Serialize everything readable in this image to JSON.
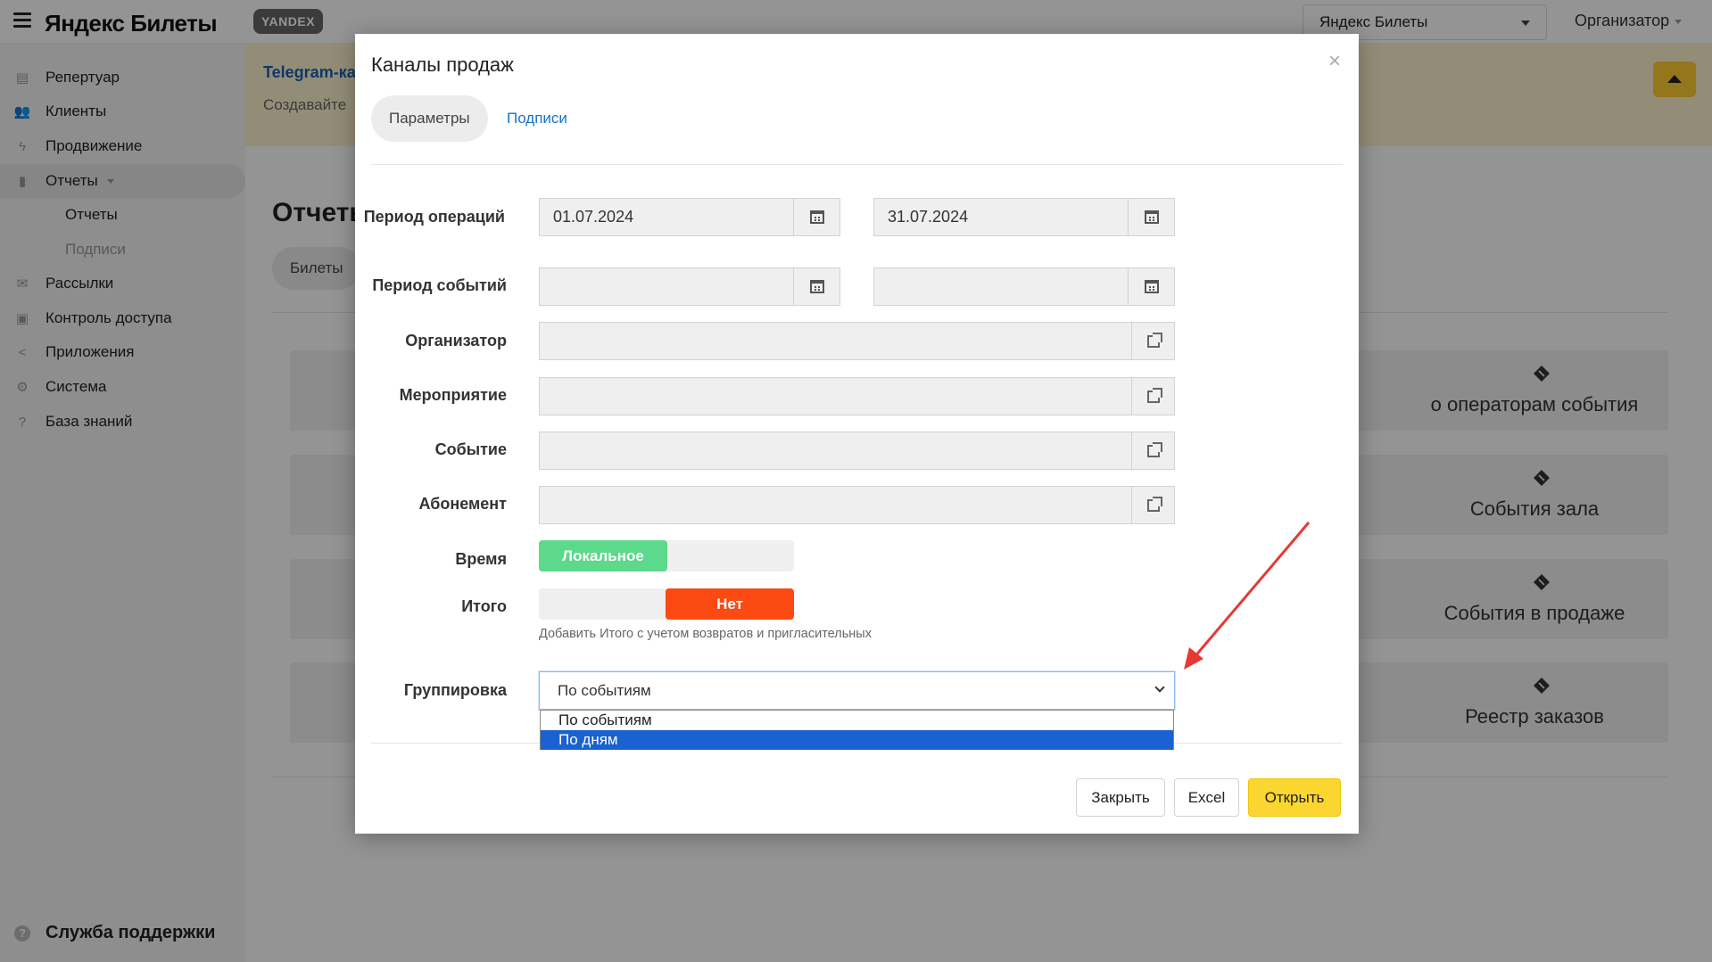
{
  "app": {
    "logo_text": "Яндекс Билеты",
    "badge": "YANDEX",
    "venue_select": "Яндекс Билеты",
    "org_menu": "Организатор"
  },
  "sidebar": {
    "items": [
      {
        "label": "Репертуар",
        "icon": "repertoire-icon"
      },
      {
        "label": "Клиенты",
        "icon": "clients-icon"
      },
      {
        "label": "Продвижение",
        "icon": "lightning-icon"
      },
      {
        "label": "Отчеты",
        "icon": "bar-chart-icon"
      },
      {
        "label": "Рассылки",
        "icon": "mail-icon"
      },
      {
        "label": "Контроль доступа",
        "icon": "access-icon"
      },
      {
        "label": "Приложения",
        "icon": "share-icon"
      },
      {
        "label": "Система",
        "icon": "gear-icon"
      },
      {
        "label": "База знаний",
        "icon": "help-icon"
      }
    ],
    "sub_items": [
      "Отчеты",
      "Подписи"
    ],
    "support": "Служба поддержки"
  },
  "page": {
    "banner_link": "Telegram-ка",
    "banner_text": "Создавайте",
    "title": "Отчеты",
    "pill": "Билеты",
    "cards": [
      "о операторам события",
      "События зала",
      "События в продаже",
      "Реестр заказов"
    ]
  },
  "modal": {
    "title": "Каналы продаж",
    "close": "×",
    "tabs": [
      "Параметры",
      "Подписи"
    ],
    "fields": {
      "period_ops_label": "Период операций",
      "period_ops_from": "01.07.2024",
      "period_ops_to": "31.07.2024",
      "period_events_label": "Период событий",
      "period_events_from": "",
      "period_events_to": "",
      "organizer_label": "Организатор",
      "event_label": "Мероприятие",
      "session_label": "Событие",
      "subscription_label": "Абонемент",
      "time_label": "Время",
      "time_option": "Локальное",
      "total_label": "Итого",
      "total_option": "Нет",
      "total_hint": "Добавить Итого с учетом возвратов и пригласительных",
      "grouping_label": "Группировка",
      "grouping_value": "По событиям",
      "grouping_options": [
        "По событиям",
        "По дням"
      ]
    },
    "buttons": {
      "close": "Закрыть",
      "excel": "Excel",
      "open": "Открыть"
    }
  },
  "colors": {
    "accent_yellow": "#fcd630",
    "toggle_green": "#5cd98b",
    "toggle_red": "#fb4a12",
    "link_blue": "#1a73c8",
    "selection_blue": "#1a62d1",
    "annotation_arrow": "#e53935"
  }
}
